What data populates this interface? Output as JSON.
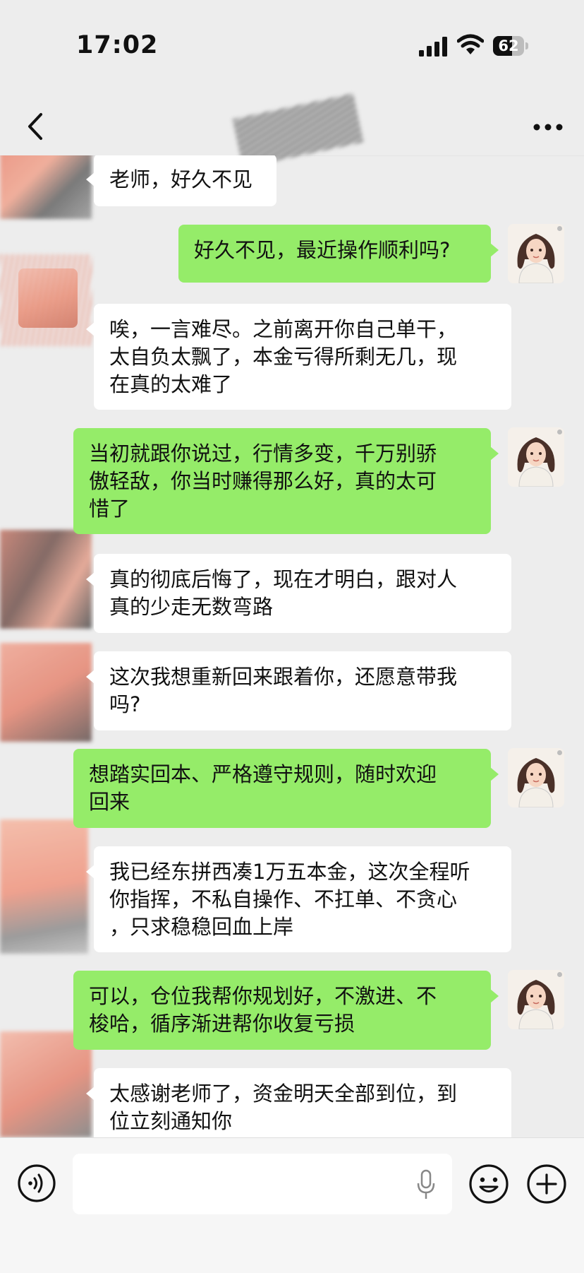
{
  "status_bar": {
    "time": "17:02",
    "battery_text": "62",
    "battery_level": 0.62
  },
  "nav": {
    "back_icon": "chevron-left-icon",
    "more_icon": "ellipsis-icon"
  },
  "messages": [
    {
      "side": "in",
      "text": "老师，好久不见"
    },
    {
      "side": "out",
      "text": "好久不见，最近操作顺利吗?"
    },
    {
      "side": "in",
      "text": "唉，一言难尽。之前离开你自己单干，\n太自负太飘了，本金亏得所剩无几，现\n在真的太难了"
    },
    {
      "side": "out",
      "text": "当初就跟你说过，行情多变，千万别骄\n傲轻敌，你当时赚得那么好，真的太可\n惜了"
    },
    {
      "side": "in",
      "text": "真的彻底后悔了，现在才明白，跟对人\n真的少走无数弯路"
    },
    {
      "side": "in",
      "text": "这次我想重新回来跟着你，还愿意带我\n吗?"
    },
    {
      "side": "out",
      "text": "想踏实回本、严格遵守规则，随时欢迎\n回来"
    },
    {
      "side": "in",
      "text": "我已经东拼西凑1万五本金，这次全程听\n你指挥，不私自操作、不扛单、不贪心\n，只求稳稳回血上岸"
    },
    {
      "side": "out",
      "text": "可以，仓位我帮你规划好，不激进、不\n梭哈，循序渐进帮你收复亏损"
    },
    {
      "side": "in",
      "text": "太感谢老师了，资金明天全部到位，到\n位立刻通知你"
    }
  ],
  "input_bar": {
    "placeholder": "",
    "voice_icon": "voice-icon",
    "mic_icon": "microphone-icon",
    "emoji_icon": "emoji-icon",
    "plus_icon": "plus-icon"
  },
  "colors": {
    "background": "#ededed",
    "bubble_out": "#95ec69",
    "bubble_in": "#ffffff"
  }
}
